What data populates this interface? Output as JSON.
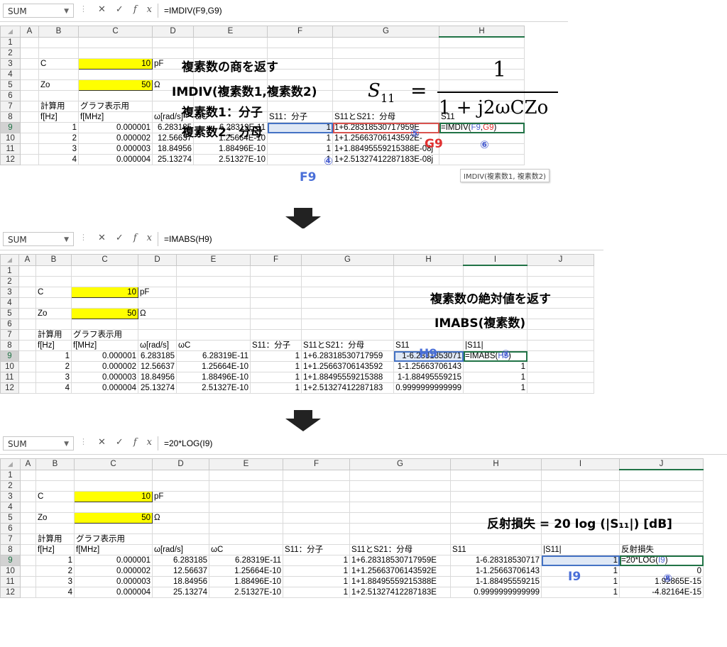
{
  "name_box": "SUM",
  "toolbar": {
    "cancel": "✕",
    "enter": "✓",
    "fx": "fx",
    "sep": "⋮"
  },
  "panel1": {
    "formula": "=IMDIV(F9,G9)",
    "cols": [
      "A",
      "B",
      "C",
      "D",
      "E",
      "F",
      "G",
      "H"
    ],
    "rows": [
      {
        "n": "1",
        "cells": [
          "",
          "",
          "",
          "",
          "",
          "",
          "",
          ""
        ]
      },
      {
        "n": "2",
        "cells": [
          "",
          "",
          "",
          "",
          "",
          "",
          "",
          ""
        ]
      },
      {
        "n": "3",
        "cells": [
          "",
          "C",
          "10",
          "pF",
          "",
          "",
          "",
          ""
        ]
      },
      {
        "n": "4",
        "cells": [
          "",
          "",
          "",
          "",
          "",
          "",
          "",
          ""
        ]
      },
      {
        "n": "5",
        "cells": [
          "",
          "Zo",
          "50",
          "Ω",
          "",
          "",
          "",
          ""
        ]
      },
      {
        "n": "6",
        "cells": [
          "",
          "",
          "",
          "",
          "",
          "",
          "",
          ""
        ]
      },
      {
        "n": "7",
        "cells": [
          "",
          "計算用",
          "グラフ表示用",
          "",
          "",
          "",
          "",
          ""
        ]
      },
      {
        "n": "8",
        "cells": [
          "",
          "f[Hz]",
          "f[MHz]",
          "ω[rad/s]",
          "ωC",
          "S11：分子",
          "S11とS21：分母",
          "S11"
        ]
      },
      {
        "n": "9",
        "cells": [
          "",
          "1",
          "0.000001",
          "6.283185",
          "6.28319E-11",
          "1",
          "1+6.28318530717959E",
          "=IMDIV(F9,G9)"
        ]
      },
      {
        "n": "10",
        "cells": [
          "",
          "2",
          "0.000002",
          "12.56637",
          "1.25664E-10",
          "1",
          "1+1.25663706143592E-",
          ""
        ]
      },
      {
        "n": "11",
        "cells": [
          "",
          "3",
          "0.000003",
          "18.84956",
          "1.88496E-10",
          "1",
          "1+1.88495559215388E-08j",
          ""
        ]
      },
      {
        "n": "12",
        "cells": [
          "",
          "4",
          "0.000004",
          "25.13274",
          "2.51327E-10",
          "1",
          "1+2.51327412287183E-08j",
          ""
        ]
      }
    ],
    "annotation_lines": [
      "複素数の商を返す",
      "IMDIV(複素数1,複素数2)",
      "複素数1：分子",
      "複素数2：分母"
    ],
    "equation": {
      "lhs": "S",
      "sub": "11",
      "eq": "=",
      "num": "1",
      "den": "1 + j2ωCZo"
    },
    "markers": {
      "m4": "④",
      "m5": "⑤",
      "m6": "⑥",
      "g9": "G9",
      "f9": "F9"
    },
    "tooltip": "IMDIV(複素数1, 複素数2)",
    "formula_parts": {
      "pre": "=IMDIV(",
      "a": "F9",
      "comma": ",",
      "b": "G9",
      "post": ")"
    }
  },
  "panel2": {
    "formula": "=IMABS(H9)",
    "cols": [
      "A",
      "B",
      "C",
      "D",
      "E",
      "F",
      "G",
      "H",
      "I",
      "J"
    ],
    "rows": [
      {
        "n": "1",
        "cells": [
          "",
          "",
          "",
          "",
          "",
          "",
          "",
          "",
          "",
          ""
        ]
      },
      {
        "n": "2",
        "cells": [
          "",
          "",
          "",
          "",
          "",
          "",
          "",
          "",
          "",
          ""
        ]
      },
      {
        "n": "3",
        "cells": [
          "",
          "C",
          "10",
          "pF",
          "",
          "",
          "",
          "",
          "",
          ""
        ]
      },
      {
        "n": "4",
        "cells": [
          "",
          "",
          "",
          "",
          "",
          "",
          "",
          "",
          "",
          ""
        ]
      },
      {
        "n": "5",
        "cells": [
          "",
          "Zo",
          "50",
          "Ω",
          "",
          "",
          "",
          "",
          "",
          ""
        ]
      },
      {
        "n": "6",
        "cells": [
          "",
          "",
          "",
          "",
          "",
          "",
          "",
          "",
          "",
          ""
        ]
      },
      {
        "n": "7",
        "cells": [
          "",
          "計算用",
          "グラフ表示用",
          "",
          "",
          "",
          "",
          "",
          "",
          ""
        ]
      },
      {
        "n": "8",
        "cells": [
          "",
          "f[Hz]",
          "f[MHz]",
          "ω[rad/s]",
          "ωC",
          "S11：分子",
          "S11とS21：分母",
          "S11",
          "|S11|",
          ""
        ]
      },
      {
        "n": "9",
        "cells": [
          "",
          "1",
          "0.000001",
          "6.283185",
          "6.28319E-11",
          "1",
          "1+6.28318530717959",
          "1-6.2831853071",
          "=IMABS(H9)",
          ""
        ]
      },
      {
        "n": "10",
        "cells": [
          "",
          "2",
          "0.000002",
          "12.56637",
          "1.25664E-10",
          "1",
          "1+1.25663706143592",
          "1-1.25663706143",
          "1",
          ""
        ]
      },
      {
        "n": "11",
        "cells": [
          "",
          "3",
          "0.000003",
          "18.84956",
          "1.88496E-10",
          "1",
          "1+1.88495559215388",
          "1-1.88495559215",
          "1",
          ""
        ]
      },
      {
        "n": "12",
        "cells": [
          "",
          "4",
          "0.000004",
          "25.13274",
          "2.51327E-10",
          "1",
          "1+2.51327412287183",
          "0.9999999999999",
          "1",
          ""
        ]
      }
    ],
    "annotation_lines": [
      "複素数の絶対値を返す",
      "IMABS(複素数)"
    ],
    "markers": {
      "h9": "H9",
      "m7": "⑦"
    },
    "formula_parts": {
      "pre": "=IMABS(",
      "a": "H9",
      "post": ")"
    }
  },
  "panel3": {
    "formula": "=20*LOG(I9)",
    "cols": [
      "A",
      "B",
      "C",
      "D",
      "E",
      "F",
      "G",
      "H",
      "I",
      "J"
    ],
    "rows": [
      {
        "n": "1",
        "cells": [
          "",
          "",
          "",
          "",
          "",
          "",
          "",
          "",
          "",
          ""
        ]
      },
      {
        "n": "2",
        "cells": [
          "",
          "",
          "",
          "",
          "",
          "",
          "",
          "",
          "",
          ""
        ]
      },
      {
        "n": "3",
        "cells": [
          "",
          "C",
          "10",
          "pF",
          "",
          "",
          "",
          "",
          "",
          ""
        ]
      },
      {
        "n": "4",
        "cells": [
          "",
          "",
          "",
          "",
          "",
          "",
          "",
          "",
          "",
          ""
        ]
      },
      {
        "n": "5",
        "cells": [
          "",
          "Zo",
          "50",
          "Ω",
          "",
          "",
          "",
          "",
          "",
          ""
        ]
      },
      {
        "n": "6",
        "cells": [
          "",
          "",
          "",
          "",
          "",
          "",
          "",
          "",
          "",
          ""
        ]
      },
      {
        "n": "7",
        "cells": [
          "",
          "計算用",
          "グラフ表示用",
          "",
          "",
          "",
          "",
          "",
          "",
          ""
        ]
      },
      {
        "n": "8",
        "cells": [
          "",
          "f[Hz]",
          "f[MHz]",
          "ω[rad/s]",
          "ωC",
          "S11：分子",
          "S11とS21：分母",
          "S11",
          "|S11|",
          "反射損失"
        ]
      },
      {
        "n": "9",
        "cells": [
          "",
          "1",
          "0.000001",
          "6.283185",
          "6.28319E-11",
          "1",
          "1+6.28318530717959E",
          "1-6.28318530717",
          "1",
          "=20*LOG(I9)"
        ]
      },
      {
        "n": "10",
        "cells": [
          "",
          "2",
          "0.000002",
          "12.56637",
          "1.25664E-10",
          "1",
          "1+1.25663706143592E",
          "1-1.25663706143",
          "1",
          "0"
        ]
      },
      {
        "n": "11",
        "cells": [
          "",
          "3",
          "0.000003",
          "18.84956",
          "1.88496E-10",
          "1",
          "1+1.88495559215388E",
          "1-1.88495559215",
          "1",
          "1.92865E-15"
        ]
      },
      {
        "n": "12",
        "cells": [
          "",
          "4",
          "0.000004",
          "25.13274",
          "2.51327E-10",
          "1",
          "1+2.51327412287183E",
          "0.9999999999999",
          "1",
          "-4.82164E-15"
        ]
      }
    ],
    "annotation": "反射損失 = 20 log (|S₁₁|) [dB]",
    "markers": {
      "i9": "I9",
      "m8": "⑧"
    },
    "formula_parts": {
      "pre": "=20*LOG(",
      "a": "I9",
      "post": ")"
    }
  },
  "colors": {
    "yellow": "#ffff00",
    "select_blue": "#4472c4",
    "accent_green": "#217346",
    "marker_blue": "#4a5fd0",
    "marker_red": "#e03030"
  }
}
